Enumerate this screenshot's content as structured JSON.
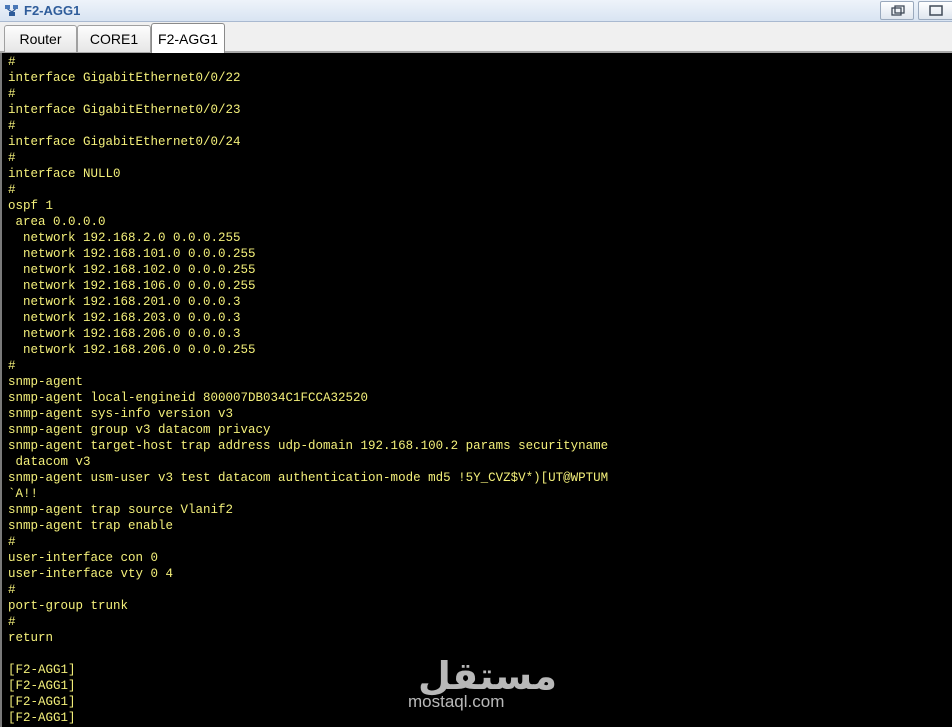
{
  "window": {
    "title": "F2-AGG1",
    "app_icon": "network-device-icon",
    "buttons": [
      "restore-icon",
      "maximize-icon"
    ]
  },
  "tabs": [
    {
      "label": "Router",
      "active": false
    },
    {
      "label": "CORE1",
      "active": false
    },
    {
      "label": "F2-AGG1",
      "active": true
    }
  ],
  "colors": {
    "console_bg": "#000000",
    "console_text": "#f4f07a",
    "title_text": "#2e5c9a"
  },
  "console": {
    "lines": [
      "#",
      "interface GigabitEthernet0/0/22",
      "#",
      "interface GigabitEthernet0/0/23",
      "#",
      "interface GigabitEthernet0/0/24",
      "#",
      "interface NULL0",
      "#",
      "ospf 1",
      " area 0.0.0.0",
      "  network 192.168.2.0 0.0.0.255",
      "  network 192.168.101.0 0.0.0.255",
      "  network 192.168.102.0 0.0.0.255",
      "  network 192.168.106.0 0.0.0.255",
      "  network 192.168.201.0 0.0.0.3",
      "  network 192.168.203.0 0.0.0.3",
      "  network 192.168.206.0 0.0.0.3",
      "  network 192.168.206.0 0.0.0.255",
      "#",
      "snmp-agent",
      "snmp-agent local-engineid 800007DB034C1FCCA32520",
      "snmp-agent sys-info version v3",
      "snmp-agent group v3 datacom privacy",
      "snmp-agent target-host trap address udp-domain 192.168.100.2 params securityname",
      " datacom v3",
      "snmp-agent usm-user v3 test datacom authentication-mode md5 !5Y_CVZ$V*)[UT@WPTUM",
      "`A!!",
      "snmp-agent trap source Vlanif2",
      "snmp-agent trap enable",
      "#",
      "user-interface con 0",
      "user-interface vty 0 4",
      "#",
      "port-group trunk",
      "#",
      "return",
      "",
      "[F2-AGG1]",
      "[F2-AGG1]",
      "[F2-AGG1]",
      "[F2-AGG1]"
    ]
  },
  "watermark": {
    "logo_text": "مستقل",
    "site_text": "mostaql.com"
  }
}
